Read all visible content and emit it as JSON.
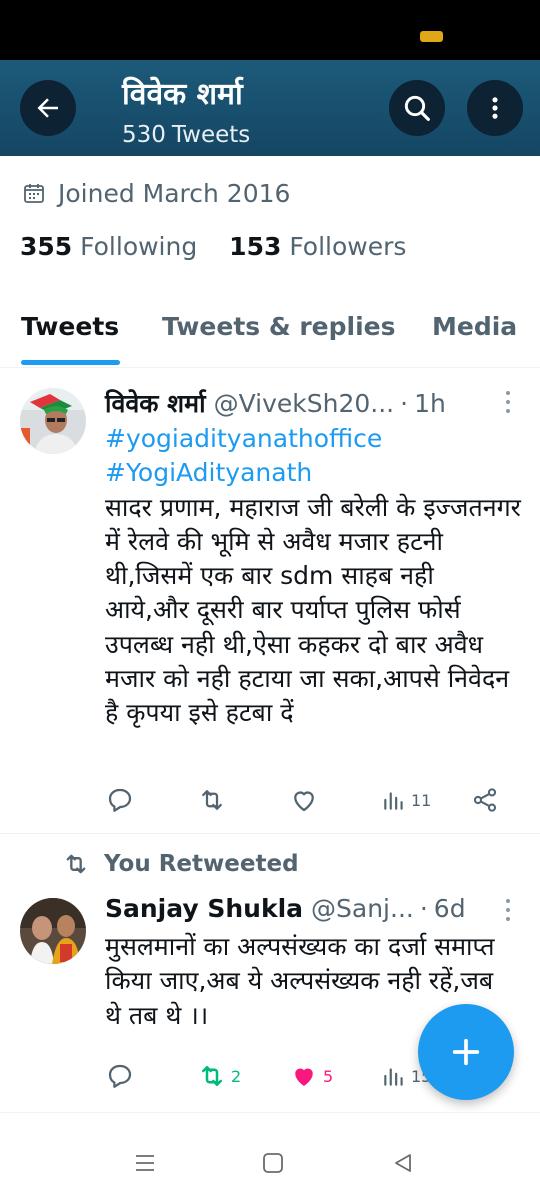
{
  "header": {
    "title": "विवेक शर्मा",
    "tweet_count": "530",
    "tweet_count_label": "Tweets",
    "background_color": "#1a5272"
  },
  "profile": {
    "joined": "Joined March 2016",
    "following_count": "355",
    "following_label": "Following",
    "followers_count": "153",
    "followers_label": "Followers"
  },
  "tabs": [
    {
      "label": "Tweets",
      "active": true
    },
    {
      "label": "Tweets & replies",
      "active": false
    },
    {
      "label": "Media",
      "active": false
    }
  ],
  "tweets": [
    {
      "name": "विवेक शर्मा",
      "handle": "@VivekSh20...",
      "time": "1h",
      "hashtags": [
        "#yogiadityanathoffice",
        "#YogiAdityanath"
      ],
      "text": "सादर प्रणाम, महाराज जी बरेली के इज्जतनगर में रेलवे की भूमि से अवैध मजार हटनी थी,जिसमें एक बार sdm साहब नही आये,और दूसरी बार पर्याप्त पुलिस फोर्स उपलब्ध नही थी,ऐसा कहकर दो बार अवैध मजार को नही हटाया जा सका,आपसे निवेदन है कृपया इसे हटबा दें",
      "views": "11"
    },
    {
      "retweet_label": "You Retweeted",
      "name": "Sanjay Shukla",
      "handle": "@Sanj...",
      "time": "6d",
      "text": "मुसलमानों का अल्पसंख्यक का दर्जा समाप्त किया जाए,अब ये अल्पसंख्यक नही रहें,जब थे तब थे ।।",
      "retweets": "2",
      "likes": "5",
      "views": "15"
    }
  ],
  "colors": {
    "accent": "#1d9bf0",
    "retweet": "#00ba7c",
    "like": "#f91880",
    "muted": "#536471"
  },
  "icons": [
    "back-arrow-icon",
    "search-icon",
    "more-vertical-icon",
    "calendar-icon",
    "reply-icon",
    "retweet-icon",
    "like-icon",
    "views-icon",
    "share-icon",
    "compose-plus-icon"
  ]
}
